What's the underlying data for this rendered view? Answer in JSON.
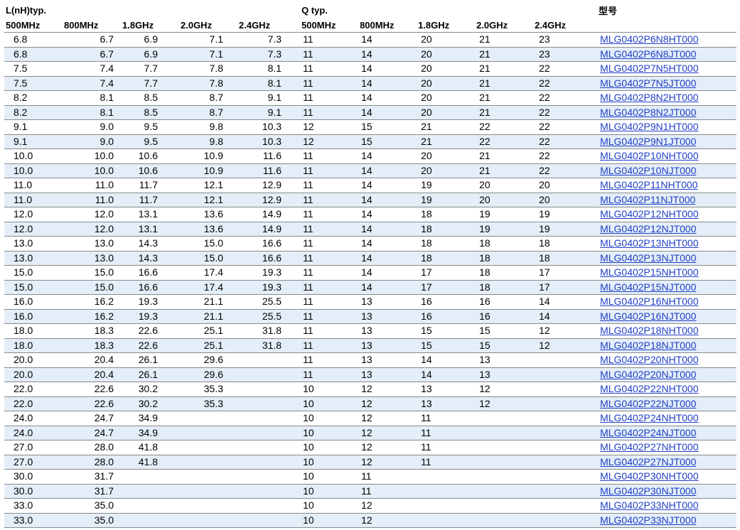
{
  "headers": {
    "l_group": "L(nH)typ.",
    "q_group": "Q typ.",
    "part_group": "型号",
    "l_freqs": [
      "500MHz",
      "800MHz",
      "1.8GHz",
      "2.0GHz",
      "2.4GHz"
    ],
    "q_freqs": [
      "500MHz",
      "800MHz",
      "1.8GHz",
      "2.0GHz",
      "2.4GHz"
    ]
  },
  "rows": [
    {
      "l": [
        "6.8",
        "6.7",
        "6.9",
        "7.1",
        "7.3"
      ],
      "q": [
        "11",
        "14",
        "20",
        "21",
        "23"
      ],
      "part": "MLG0402P6N8HT000"
    },
    {
      "l": [
        "6.8",
        "6.7",
        "6.9",
        "7.1",
        "7.3"
      ],
      "q": [
        "11",
        "14",
        "20",
        "21",
        "23"
      ],
      "part": "MLG0402P6N8JT000"
    },
    {
      "l": [
        "7.5",
        "7.4",
        "7.7",
        "7.8",
        "8.1"
      ],
      "q": [
        "11",
        "14",
        "20",
        "21",
        "22"
      ],
      "part": "MLG0402P7N5HT000"
    },
    {
      "l": [
        "7.5",
        "7.4",
        "7.7",
        "7.8",
        "8.1"
      ],
      "q": [
        "11",
        "14",
        "20",
        "21",
        "22"
      ],
      "part": "MLG0402P7N5JT000"
    },
    {
      "l": [
        "8.2",
        "8.1",
        "8.5",
        "8.7",
        "9.1"
      ],
      "q": [
        "11",
        "14",
        "20",
        "21",
        "22"
      ],
      "part": "MLG0402P8N2HT000"
    },
    {
      "l": [
        "8.2",
        "8.1",
        "8.5",
        "8.7",
        "9.1"
      ],
      "q": [
        "11",
        "14",
        "20",
        "21",
        "22"
      ],
      "part": "MLG0402P8N2JT000"
    },
    {
      "l": [
        "9.1",
        "9.0",
        "9.5",
        "9.8",
        "10.3"
      ],
      "q": [
        "12",
        "15",
        "21",
        "22",
        "22"
      ],
      "part": "MLG0402P9N1HT000"
    },
    {
      "l": [
        "9.1",
        "9.0",
        "9.5",
        "9.8",
        "10.3"
      ],
      "q": [
        "12",
        "15",
        "21",
        "22",
        "22"
      ],
      "part": "MLG0402P9N1JT000"
    },
    {
      "l": [
        "10.0",
        "10.0",
        "10.6",
        "10.9",
        "11.6"
      ],
      "q": [
        "11",
        "14",
        "20",
        "21",
        "22"
      ],
      "part": "MLG0402P10NHT000"
    },
    {
      "l": [
        "10.0",
        "10.0",
        "10.6",
        "10.9",
        "11.6"
      ],
      "q": [
        "11",
        "14",
        "20",
        "21",
        "22"
      ],
      "part": "MLG0402P10NJT000"
    },
    {
      "l": [
        "11.0",
        "11.0",
        "11.7",
        "12.1",
        "12.9"
      ],
      "q": [
        "11",
        "14",
        "19",
        "20",
        "20"
      ],
      "part": "MLG0402P11NHT000"
    },
    {
      "l": [
        "11.0",
        "11.0",
        "11.7",
        "12.1",
        "12.9"
      ],
      "q": [
        "11",
        "14",
        "19",
        "20",
        "20"
      ],
      "part": "MLG0402P11NJT000"
    },
    {
      "l": [
        "12.0",
        "12.0",
        "13.1",
        "13.6",
        "14.9"
      ],
      "q": [
        "11",
        "14",
        "18",
        "19",
        "19"
      ],
      "part": "MLG0402P12NHT000"
    },
    {
      "l": [
        "12.0",
        "12.0",
        "13.1",
        "13.6",
        "14.9"
      ],
      "q": [
        "11",
        "14",
        "18",
        "19",
        "19"
      ],
      "part": "MLG0402P12NJT000"
    },
    {
      "l": [
        "13.0",
        "13.0",
        "14.3",
        "15.0",
        "16.6"
      ],
      "q": [
        "11",
        "14",
        "18",
        "18",
        "18"
      ],
      "part": "MLG0402P13NHT000"
    },
    {
      "l": [
        "13.0",
        "13.0",
        "14.3",
        "15.0",
        "16.6"
      ],
      "q": [
        "11",
        "14",
        "18",
        "18",
        "18"
      ],
      "part": "MLG0402P13NJT000"
    },
    {
      "l": [
        "15.0",
        "15.0",
        "16.6",
        "17.4",
        "19.3"
      ],
      "q": [
        "11",
        "14",
        "17",
        "18",
        "17"
      ],
      "part": "MLG0402P15NHT000"
    },
    {
      "l": [
        "15.0",
        "15.0",
        "16.6",
        "17.4",
        "19.3"
      ],
      "q": [
        "11",
        "14",
        "17",
        "18",
        "17"
      ],
      "part": "MLG0402P15NJT000"
    },
    {
      "l": [
        "16.0",
        "16.2",
        "19.3",
        "21.1",
        "25.5"
      ],
      "q": [
        "11",
        "13",
        "16",
        "16",
        "14"
      ],
      "part": "MLG0402P16NHT000"
    },
    {
      "l": [
        "16.0",
        "16.2",
        "19.3",
        "21.1",
        "25.5"
      ],
      "q": [
        "11",
        "13",
        "16",
        "16",
        "14"
      ],
      "part": "MLG0402P16NJT000"
    },
    {
      "l": [
        "18.0",
        "18.3",
        "22.6",
        "25.1",
        "31.8"
      ],
      "q": [
        "11",
        "13",
        "15",
        "15",
        "12"
      ],
      "part": "MLG0402P18NHT000"
    },
    {
      "l": [
        "18.0",
        "18.3",
        "22.6",
        "25.1",
        "31.8"
      ],
      "q": [
        "11",
        "13",
        "15",
        "15",
        "12"
      ],
      "part": "MLG0402P18NJT000"
    },
    {
      "l": [
        "20.0",
        "20.4",
        "26.1",
        "29.6",
        ""
      ],
      "q": [
        "11",
        "13",
        "14",
        "13",
        ""
      ],
      "part": "MLG0402P20NHT000"
    },
    {
      "l": [
        "20.0",
        "20.4",
        "26.1",
        "29.6",
        ""
      ],
      "q": [
        "11",
        "13",
        "14",
        "13",
        ""
      ],
      "part": "MLG0402P20NJT000"
    },
    {
      "l": [
        "22.0",
        "22.6",
        "30.2",
        "35.3",
        ""
      ],
      "q": [
        "10",
        "12",
        "13",
        "12",
        ""
      ],
      "part": "MLG0402P22NHT000"
    },
    {
      "l": [
        "22.0",
        "22.6",
        "30.2",
        "35.3",
        ""
      ],
      "q": [
        "10",
        "12",
        "13",
        "12",
        ""
      ],
      "part": "MLG0402P22NJT000"
    },
    {
      "l": [
        "24.0",
        "24.7",
        "34.9",
        "",
        ""
      ],
      "q": [
        "10",
        "12",
        "11",
        "",
        ""
      ],
      "part": "MLG0402P24NHT000"
    },
    {
      "l": [
        "24.0",
        "24.7",
        "34.9",
        "",
        ""
      ],
      "q": [
        "10",
        "12",
        "11",
        "",
        ""
      ],
      "part": "MLG0402P24NJT000"
    },
    {
      "l": [
        "27.0",
        "28.0",
        "41.8",
        "",
        ""
      ],
      "q": [
        "10",
        "12",
        "11",
        "",
        ""
      ],
      "part": "MLG0402P27NHT000"
    },
    {
      "l": [
        "27.0",
        "28.0",
        "41.8",
        "",
        ""
      ],
      "q": [
        "10",
        "12",
        "11",
        "",
        ""
      ],
      "part": "MLG0402P27NJT000"
    },
    {
      "l": [
        "30.0",
        "31.7",
        "",
        "",
        ""
      ],
      "q": [
        "10",
        "11",
        "",
        "",
        ""
      ],
      "part": "MLG0402P30NHT000"
    },
    {
      "l": [
        "30.0",
        "31.7",
        "",
        "",
        ""
      ],
      "q": [
        "10",
        "11",
        "",
        "",
        ""
      ],
      "part": "MLG0402P30NJT000"
    },
    {
      "l": [
        "33.0",
        "35.0",
        "",
        "",
        ""
      ],
      "q": [
        "10",
        "12",
        "",
        "",
        ""
      ],
      "part": "MLG0402P33NHT000"
    },
    {
      "l": [
        "33.0",
        "35.0",
        "",
        "",
        ""
      ],
      "q": [
        "10",
        "12",
        "",
        "",
        ""
      ],
      "part": "MLG0402P33NJT000"
    }
  ],
  "colors": {
    "stripe": "#e4eef8",
    "link": "#1f3fc8",
    "rule": "#8a8a8a"
  }
}
